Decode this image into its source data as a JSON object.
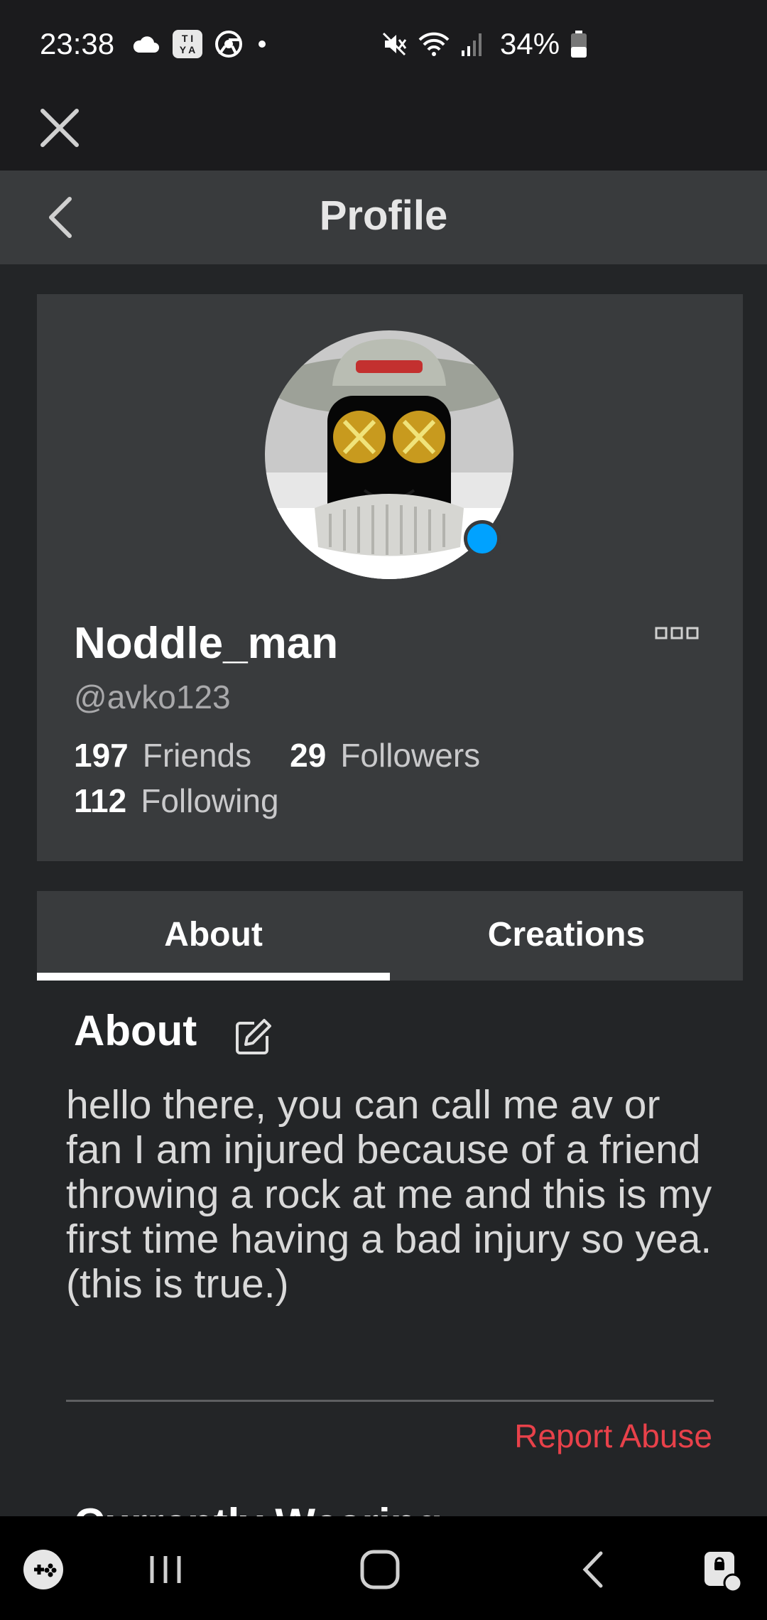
{
  "status_bar": {
    "time": "23:38",
    "ti_badge_line1": "T I",
    "ti_badge_line2": "Y A",
    "battery": "34%",
    "icons": [
      "cloud-icon",
      "ti-badge-icon",
      "chrome-icon",
      "dot-icon",
      "mute-icon",
      "wifi-icon",
      "signal-icon",
      "battery-icon"
    ]
  },
  "header": {
    "title": "Profile"
  },
  "profile": {
    "display_name": "Noddle_man",
    "username": "@avko123",
    "online": true,
    "online_color": "#00a2ff",
    "stats": {
      "friends_count": "197",
      "friends_label": "Friends",
      "followers_count": "29",
      "followers_label": "Followers",
      "following_count": "112",
      "following_label": "Following"
    }
  },
  "tabs": [
    {
      "label": "About",
      "active": true
    },
    {
      "label": "Creations",
      "active": false
    }
  ],
  "about": {
    "heading": "About",
    "text": "hello there, you can call me av or fan I am injured because of a friend throwing a rock at me and this is my first time having a bad injury so yea. (this is true.)",
    "report_label": "Report Abuse",
    "report_color": "#e8414a",
    "next_heading": "Currently Wearing"
  },
  "nav_bar": {
    "icons": [
      "game-launcher-icon",
      "recents-icon",
      "home-icon",
      "back-icon",
      "assistant-icon"
    ]
  }
}
